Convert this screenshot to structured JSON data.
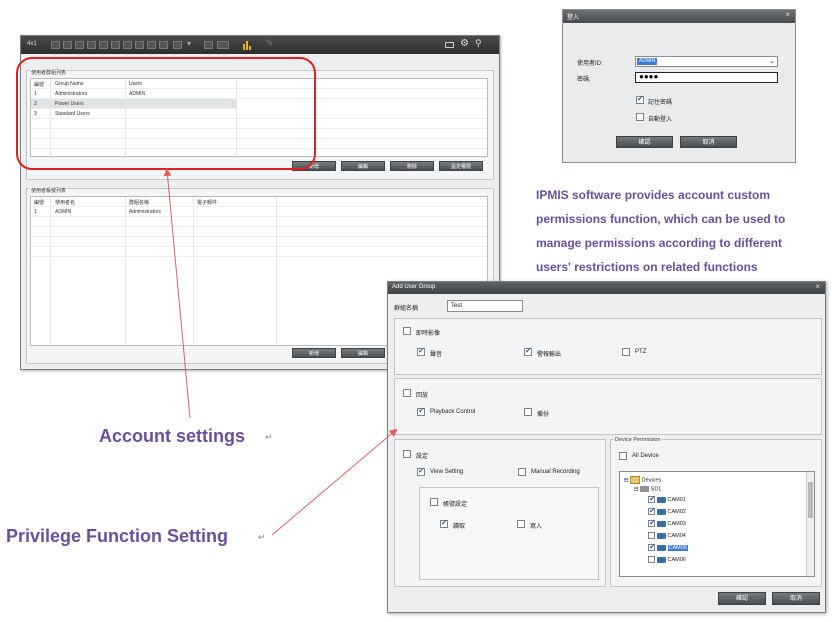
{
  "main_window": {
    "title": "4x1",
    "group_section_title": "使用者群組列表",
    "group_table": {
      "headers": [
        "編號",
        "Group Name",
        "Users"
      ],
      "rows": [
        [
          "1",
          "Administrators",
          "ADMIN"
        ],
        [
          "2",
          "Power Users",
          ""
        ],
        [
          "3",
          "Standard Users",
          ""
        ]
      ]
    },
    "group_buttons": [
      "新增",
      "編輯",
      "刪除",
      "設定權限"
    ],
    "user_section_title": "使用者帳號列表",
    "user_table": {
      "headers": [
        "編號",
        "使用者名",
        "群組名稱",
        "電子郵件"
      ],
      "rows": [
        [
          "1",
          "ADMIN",
          "Administrators",
          ""
        ]
      ]
    },
    "user_buttons": [
      "新增",
      "編輯"
    ]
  },
  "login_dialog": {
    "title": "登入",
    "username_label": "使用者ID:",
    "username_value": "ADMIN",
    "password_label": "密碼:",
    "password_value": "●●●●",
    "remember_label": "記住密碼",
    "remember_checked": true,
    "autologin_label": "自動登入",
    "autologin_checked": false,
    "ok_label": "確認",
    "cancel_label": "取消"
  },
  "add_user_group": {
    "title": "Add User Group",
    "name_label": "群組名稱",
    "name_value": "Test",
    "sections": {
      "live": {
        "label": "即時影像",
        "options": [
          {
            "label": "聲音",
            "checked": true
          },
          {
            "label": "警報輸出",
            "checked": true
          },
          {
            "label": "PTZ",
            "checked": false
          }
        ]
      },
      "playback": {
        "label": "回放",
        "options": [
          {
            "label": "Playback Control",
            "checked": true
          },
          {
            "label": "備份",
            "checked": false
          }
        ]
      },
      "setting": {
        "label": "設定",
        "options": [
          {
            "label": "View Setting",
            "checked": true
          },
          {
            "label": "Manual Recording",
            "checked": false
          }
        ],
        "sub_label": "帳號設定",
        "sub_options": [
          {
            "label": "讀取",
            "checked": true
          },
          {
            "label": "寫入",
            "checked": false
          }
        ]
      }
    },
    "device_permission": {
      "label": "Device Permission",
      "all_device_label": "All Device",
      "tree_root": "Devices",
      "tree_server": "SD1",
      "cameras": [
        {
          "label": "CAM01",
          "checked": true
        },
        {
          "label": "CAM02",
          "checked": true
        },
        {
          "label": "CAM03",
          "checked": true
        },
        {
          "label": "CAM04",
          "checked": false
        },
        {
          "label": "CAM05",
          "checked": true
        },
        {
          "label": "CAM06",
          "checked": false
        }
      ]
    },
    "ok_label": "確認",
    "cancel_label": "取消"
  },
  "annotations": {
    "description_lines": [
      "IPMIS software provides account custom",
      "permissions function, which can be used to",
      "manage permissions according to different",
      "users' restrictions on related functions"
    ],
    "account_settings": "Account settings",
    "privilege_setting": "Privilege Function Setting",
    "text_color": "#6a4fa1",
    "highlight_color": "#e02020",
    "arrow_color": "#e06060"
  }
}
